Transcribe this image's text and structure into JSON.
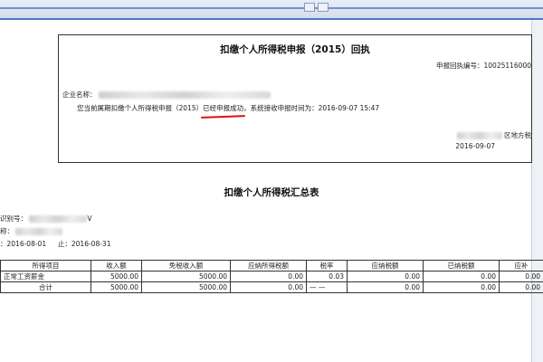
{
  "receipt": {
    "title": "扣缴个人所得税申报（2015）回执",
    "receipt_no": "申报回执编号：10025116000",
    "company_label": "企业名称：",
    "status_prefix": "您当前属期扣缴个人所得税申报（2015）",
    "status_success": "已经申报成功",
    "status_suffix": "，系统接收申报时间为：2016-09-07 15:47",
    "tax_office": "区地方税",
    "date": "2016-09-07"
  },
  "summary": {
    "title": "扣缴个人所得税汇总表",
    "tax_no_label": "识别号：",
    "tax_no_suffix": "V",
    "name_label": "称：",
    "period_from_label": "：",
    "period_from": "2016-08-01",
    "period_to_label": "止：",
    "period_to": "2016-08-31",
    "columns": [
      "所得项目",
      "收入额",
      "免税收入额",
      "应纳所得税额",
      "税率",
      "应纳税额",
      "已纳税额",
      "应补"
    ],
    "rows": [
      [
        "正常工资薪金",
        "5000.00",
        "5000.00",
        "0.00",
        "0.03",
        "0.00",
        "0.00",
        "0.00"
      ],
      [
        "合计",
        "5000.00",
        "5000.00",
        "0.00",
        "— —",
        "0.00",
        "0.00",
        "0.00"
      ]
    ]
  },
  "colors": {
    "accent": "#4a78c7",
    "highlight": "#e01010"
  }
}
